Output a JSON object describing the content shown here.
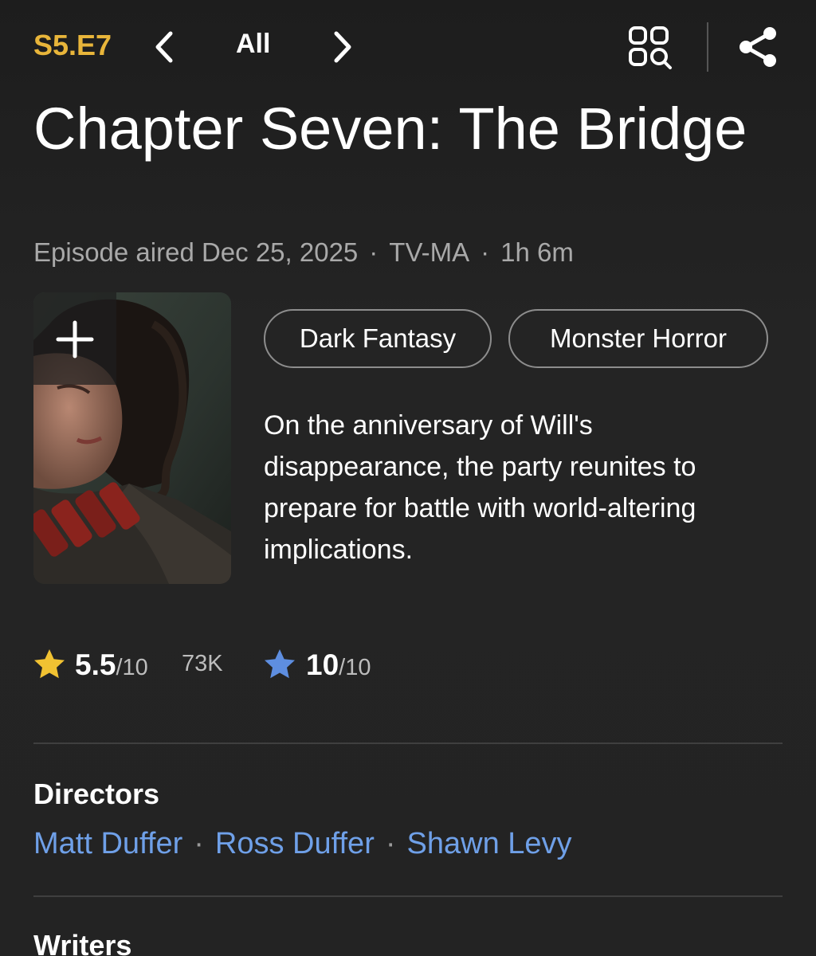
{
  "header": {
    "episode_code": "S5.E7",
    "filter_label": "All"
  },
  "episode": {
    "title": "Chapter Seven: The Bridge",
    "aired": "Episode aired Dec 25, 2025",
    "rating_cert": "TV-MA",
    "runtime": "1h 6m",
    "separator": "·"
  },
  "genres": [
    "Dark Fantasy",
    "Monster Horror"
  ],
  "description": "On the anniversary of Will's disappearance, the party reunites to prepare for battle with world-altering implications.",
  "ratings": {
    "imdb_score": "5.5",
    "imdb_scale": "/10",
    "vote_count": "73K",
    "user_score": "10",
    "user_scale": "/10"
  },
  "sections": {
    "directors_title": "Directors",
    "writers_title": "Writers"
  },
  "directors": [
    "Matt Duffer",
    "Ross Duffer",
    "Shawn Levy"
  ],
  "colors": {
    "background": "#222222",
    "episode_code": "#e8b53a",
    "imdb_star": "#f1c232",
    "user_star": "#5e8ee0",
    "link": "#6fa0e8",
    "muted_text": "#a9a9a9"
  },
  "icons": {
    "prev": "chevron-left-icon",
    "next": "chevron-right-icon",
    "episode_grid": "grid-search-icon",
    "share": "share-icon",
    "add": "plus-icon",
    "imdb_rating": "star-icon",
    "user_rating": "star-icon"
  }
}
